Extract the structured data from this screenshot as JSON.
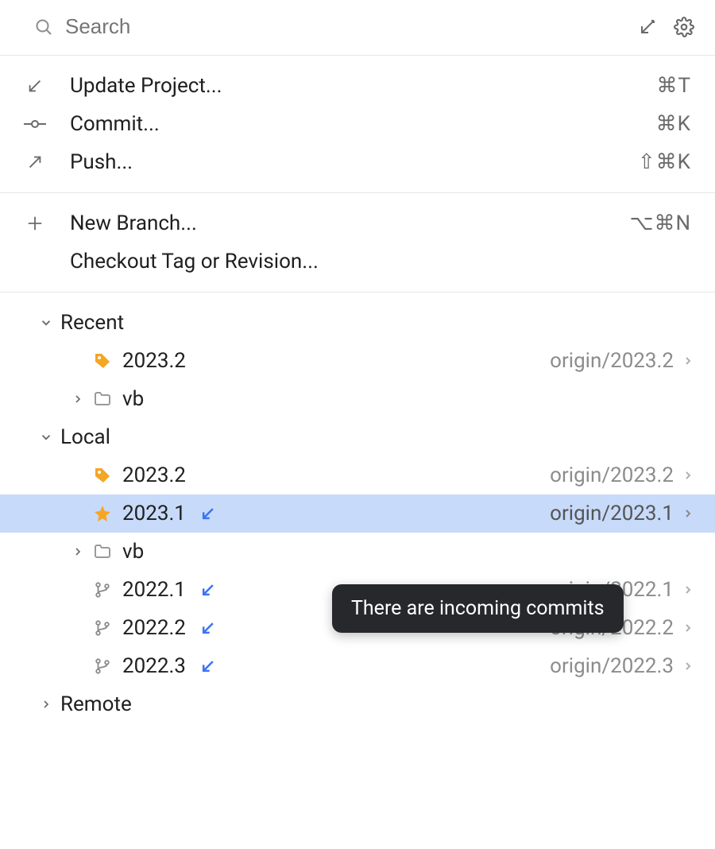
{
  "search": {
    "placeholder": "Search"
  },
  "topActions": [
    {
      "label": "Update Project...",
      "shortcut": "⌘T"
    },
    {
      "label": "Commit...",
      "shortcut": "⌘K"
    },
    {
      "label": "Push...",
      "shortcut": "⇧⌘K"
    }
  ],
  "branchActions": [
    {
      "label": "New Branch...",
      "shortcut": "⌥⌘N"
    },
    {
      "label": "Checkout Tag or Revision...",
      "shortcut": ""
    }
  ],
  "tree": {
    "recent": {
      "title": "Recent",
      "items": [
        {
          "name": "2023.2",
          "remote": "origin/2023.2"
        },
        {
          "name": "vb"
        }
      ]
    },
    "local": {
      "title": "Local",
      "items": [
        {
          "name": "2023.2",
          "remote": "origin/2023.2"
        },
        {
          "name": "2023.1",
          "remote": "origin/2023.1"
        },
        {
          "name": "vb"
        },
        {
          "name": "2022.1",
          "remote": "origin/2022.1"
        },
        {
          "name": "2022.2",
          "remote": "origin/2022.2"
        },
        {
          "name": "2022.3",
          "remote": "origin/2022.3"
        }
      ]
    },
    "remote": {
      "title": "Remote"
    }
  },
  "tooltip": "There are incoming commits"
}
